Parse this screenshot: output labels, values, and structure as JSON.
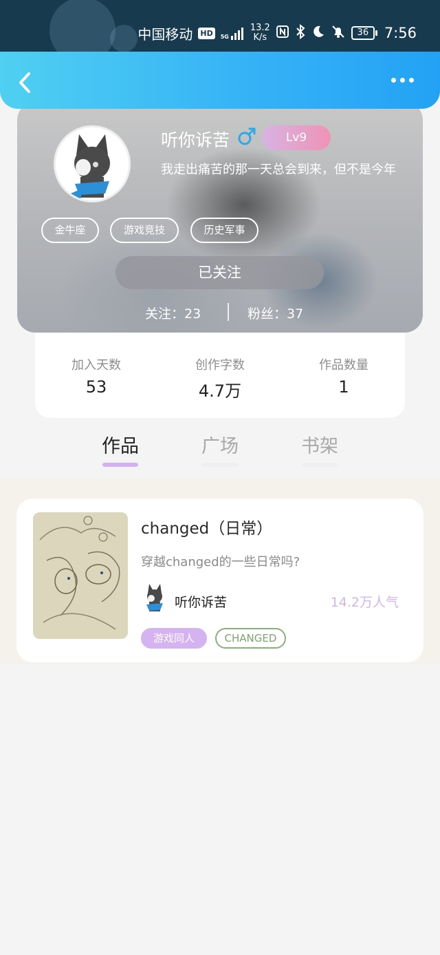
{
  "status_bar": {
    "carrier": "中国移动",
    "hd": "HD",
    "network": "5G",
    "speed_value": "13.2",
    "speed_unit": "K/s",
    "battery": "36",
    "time": "7:56"
  },
  "header": {
    "back_icon": "chevron-left-icon",
    "more_icon": "more-dots-icon"
  },
  "profile": {
    "username": "听你诉苦",
    "gender_symbol": "♂",
    "level": "Lv9",
    "signature": "我走出痛苦的那一天总会到来，但不是今年",
    "tags": [
      "金牛座",
      "游戏竞技",
      "历史军事"
    ],
    "follow_button": "已关注",
    "following": "关注：23",
    "followers": "粉丝：37"
  },
  "stats": [
    {
      "label": "加入天数",
      "value": "53"
    },
    {
      "label": "创作字数",
      "value": "4.7万"
    },
    {
      "label": "作品数量",
      "value": "1"
    }
  ],
  "tabs": [
    {
      "label": "作品",
      "active": true
    },
    {
      "label": "广场",
      "active": false
    },
    {
      "label": "书架",
      "active": false
    }
  ],
  "works": [
    {
      "title": "changed（日常）",
      "description": "穿越changed的一些日常吗?",
      "author": "听你诉苦",
      "popularity": "14.2万人气",
      "genre_tag": "游戏同人",
      "series_tag": "CHANGED"
    }
  ],
  "colors": {
    "header_gradient_start": "#4fd0f2",
    "header_gradient_end": "#23a2f5",
    "accent_purple": "#d3b1ef",
    "gender_blue": "#2fa8e8",
    "series_tag_green": "#8ab07a"
  }
}
